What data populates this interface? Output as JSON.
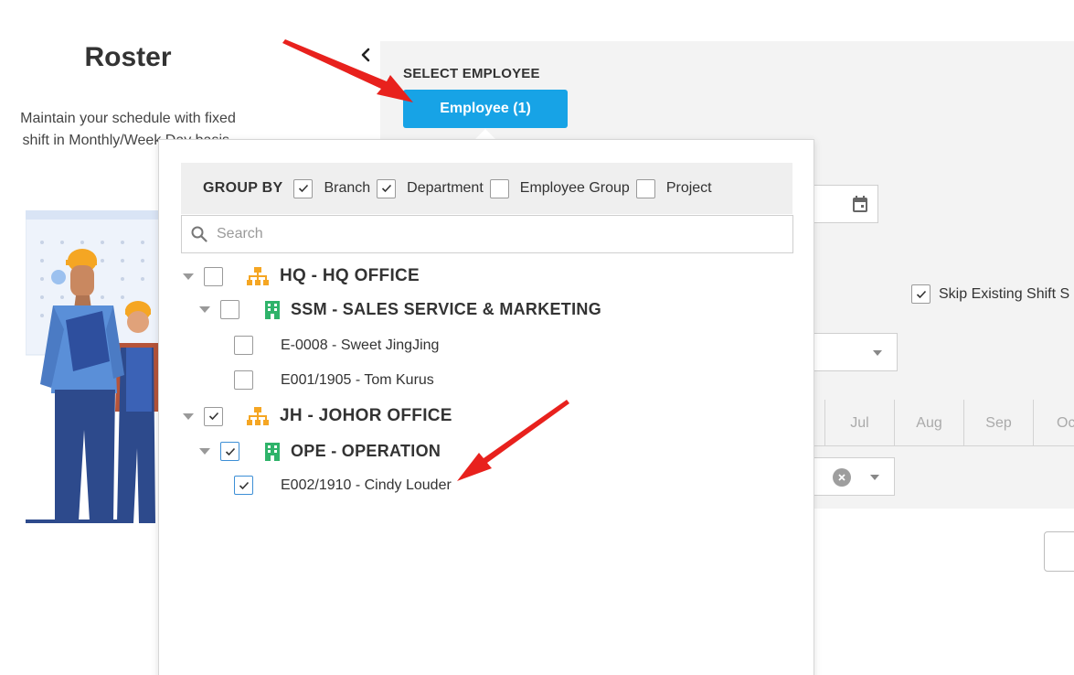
{
  "left_panel": {
    "title": "Roster",
    "description": "Maintain your schedule with fixed shift in Monthly/Week Day basis."
  },
  "header": {
    "select_label": "SELECT EMPLOYEE",
    "employee_button": "Employee (1)"
  },
  "options": {
    "skip_existing": "Skip Existing Shift S",
    "skip_existing_checked": true
  },
  "months": [
    "",
    "Jul",
    "Aug",
    "Sep",
    "Oct"
  ],
  "picker": {
    "group_by_label": "GROUP BY",
    "group_by": [
      {
        "label": "Branch",
        "checked": true
      },
      {
        "label": "Department",
        "checked": true
      },
      {
        "label": "Employee Group",
        "checked": false
      },
      {
        "label": "Project",
        "checked": false
      }
    ],
    "search_placeholder": "Search",
    "tree": [
      {
        "label": "HQ - HQ OFFICE",
        "checked": false
      },
      {
        "label": "SSM - SALES SERVICE & MARKETING",
        "checked": false
      },
      {
        "label": "E-0008 - Sweet JingJing",
        "checked": false
      },
      {
        "label": "E001/1905 - Tom Kurus",
        "checked": false
      },
      {
        "label": "JH - JOHOR OFFICE",
        "checked": true
      },
      {
        "label": "OPE - OPERATION",
        "checked": true
      },
      {
        "label": "E002/1910 - Cindy Louder",
        "checked": true
      }
    ]
  },
  "colors": {
    "primary": "#17a3e6",
    "branch_icon": "#f5a623",
    "department_icon": "#2fb36a",
    "annotation_arrow": "#e8211d"
  }
}
